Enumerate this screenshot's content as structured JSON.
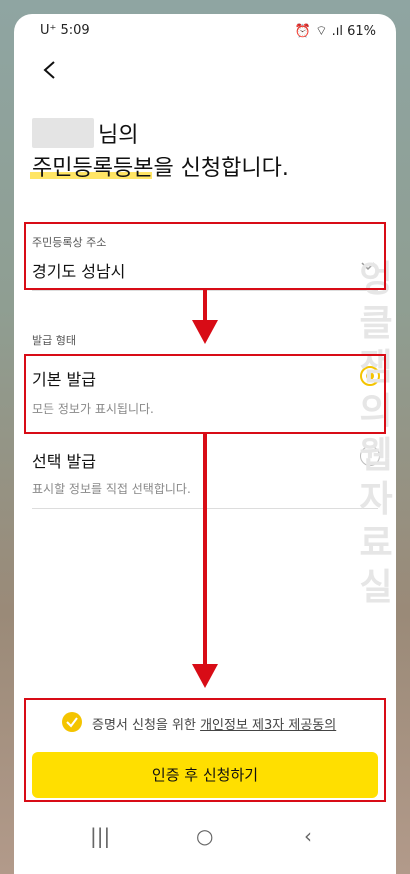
{
  "status": {
    "carrier": "U⁺ 5:09",
    "battery": "61%"
  },
  "header": {
    "greeting_suffix": "님의",
    "title": "주민등록등본을 신청합니다."
  },
  "address": {
    "label": "주민등록상 주소",
    "value": "경기도 성남시"
  },
  "issue": {
    "label": "발급 형태",
    "options": [
      {
        "title": "기본 발급",
        "desc": "모든 정보가 표시됩니다.",
        "selected": true
      },
      {
        "title": "선택 발급",
        "desc": "표시할 정보를 직접 선택합니다.",
        "selected": false
      }
    ]
  },
  "agreement": {
    "prefix": "증명서 신청을 위한 ",
    "link": "개인정보 제3자 제공동의"
  },
  "submit": {
    "label": "인증 후 신청하기"
  },
  "watermark": "엉클잼의웹자료실",
  "colors": {
    "accent": "#ffdf00",
    "annotation": "#d80c16"
  }
}
